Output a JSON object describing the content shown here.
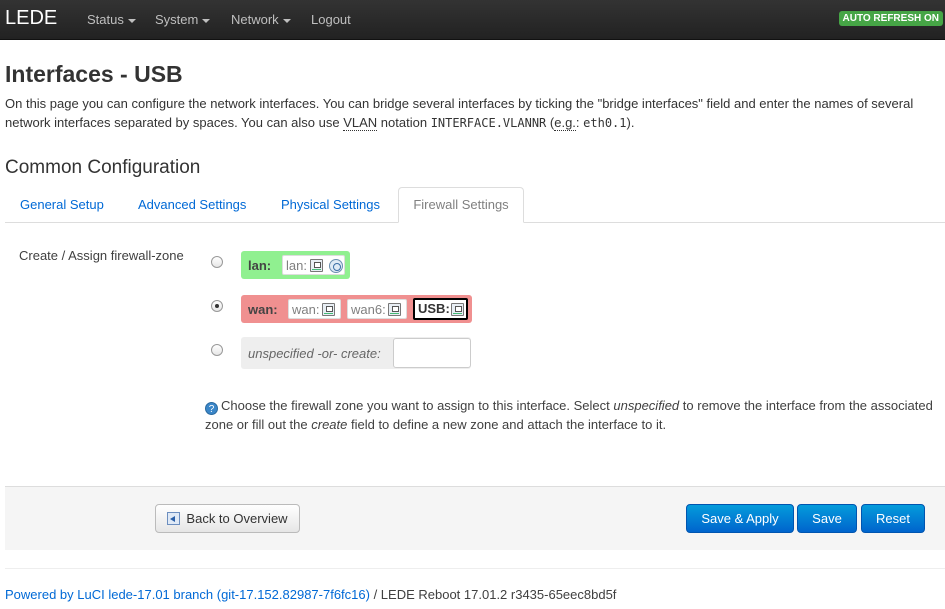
{
  "topbar": {
    "brand": "LEDE",
    "menu": [
      {
        "label": "Status",
        "dropdown": true
      },
      {
        "label": "System",
        "dropdown": true
      },
      {
        "label": "Network",
        "dropdown": true
      },
      {
        "label": "Logout",
        "dropdown": false
      }
    ],
    "auto_refresh": "AUTO REFRESH ON"
  },
  "page": {
    "title": "Interfaces - USB",
    "desc_1": "On this page you can configure the network interfaces. You can bridge several interfaces by ticking the \"bridge interfaces\" field and enter the names of several network interfaces separated by spaces. You can also use ",
    "desc_vlan": "VLAN",
    "desc_2": " notation ",
    "desc_code1": "INTERFACE.VLANNR",
    "desc_3": " (",
    "desc_eg": "e.g.",
    "desc_4": ": ",
    "desc_code2": "eth0.1",
    "desc_5": ")."
  },
  "section": {
    "title": "Common Configuration"
  },
  "tabs": [
    {
      "label": "General Setup",
      "active": false
    },
    {
      "label": "Advanced Settings",
      "active": false
    },
    {
      "label": "Physical Settings",
      "active": false
    },
    {
      "label": "Firewall Settings",
      "active": true
    }
  ],
  "firewall": {
    "field_label": "Create / Assign firewall-zone",
    "zones": [
      {
        "name": "lan:",
        "color": "#90f090",
        "selected": false,
        "interfaces": [
          "lan:"
        ]
      },
      {
        "name": "wan:",
        "color": "#f09090",
        "selected": true,
        "interfaces": [
          "wan:",
          "wan6:",
          "USB:"
        ]
      }
    ],
    "unspecified_label": "unspecified -or- create:",
    "create_value": "",
    "help_1": "Choose the firewall zone you want to assign to this interface. Select ",
    "help_unspecified": "unspecified",
    "help_2": " to remove the interface from the associated zone or fill out the ",
    "help_create": "create",
    "help_3": " field to define a new zone and attach the interface to it."
  },
  "actions": {
    "back": "Back to Overview",
    "save_apply": "Save & Apply",
    "save": "Save",
    "reset": "Reset"
  },
  "footer": {
    "link": "Powered by LuCI lede-17.01 branch (git-17.152.82987-7f6fc16)",
    "rest": " / LEDE Reboot 17.01.2 r3435-65eec8bd5f"
  },
  "colors": {
    "primary": "#0064cd",
    "link": "#0069d6",
    "lan_zone": "#90f090",
    "wan_zone": "#f09090",
    "autorefresh": "#46a546"
  }
}
